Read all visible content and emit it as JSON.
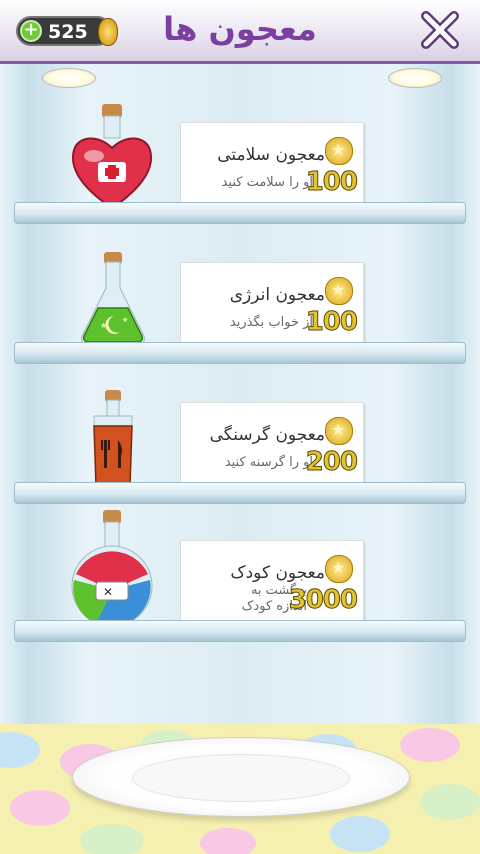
{
  "header": {
    "title": "معجون ها",
    "coin_count": "525"
  },
  "potions": [
    {
      "name": "معجون سلامتی",
      "description": "او را سلامت کنید",
      "price": "100",
      "icon": "heart-potion-icon",
      "color": "#e0304a"
    },
    {
      "name": "معجون انرژی",
      "description": "از خواب بگذرید",
      "price": "100",
      "icon": "moon-potion-icon",
      "color": "#5cc12c"
    },
    {
      "name": "معجون گرسنگی",
      "description": "او را گرسنه کنید",
      "price": "200",
      "icon": "fork-knife-potion-icon",
      "color": "#d2521f"
    },
    {
      "name": "معجون کودک",
      "description_line1": "برگشت به",
      "description_line2": "اندازه کودک",
      "price": "3000",
      "icon": "shrink-potion-icon",
      "color": "#3a8fd8"
    }
  ]
}
